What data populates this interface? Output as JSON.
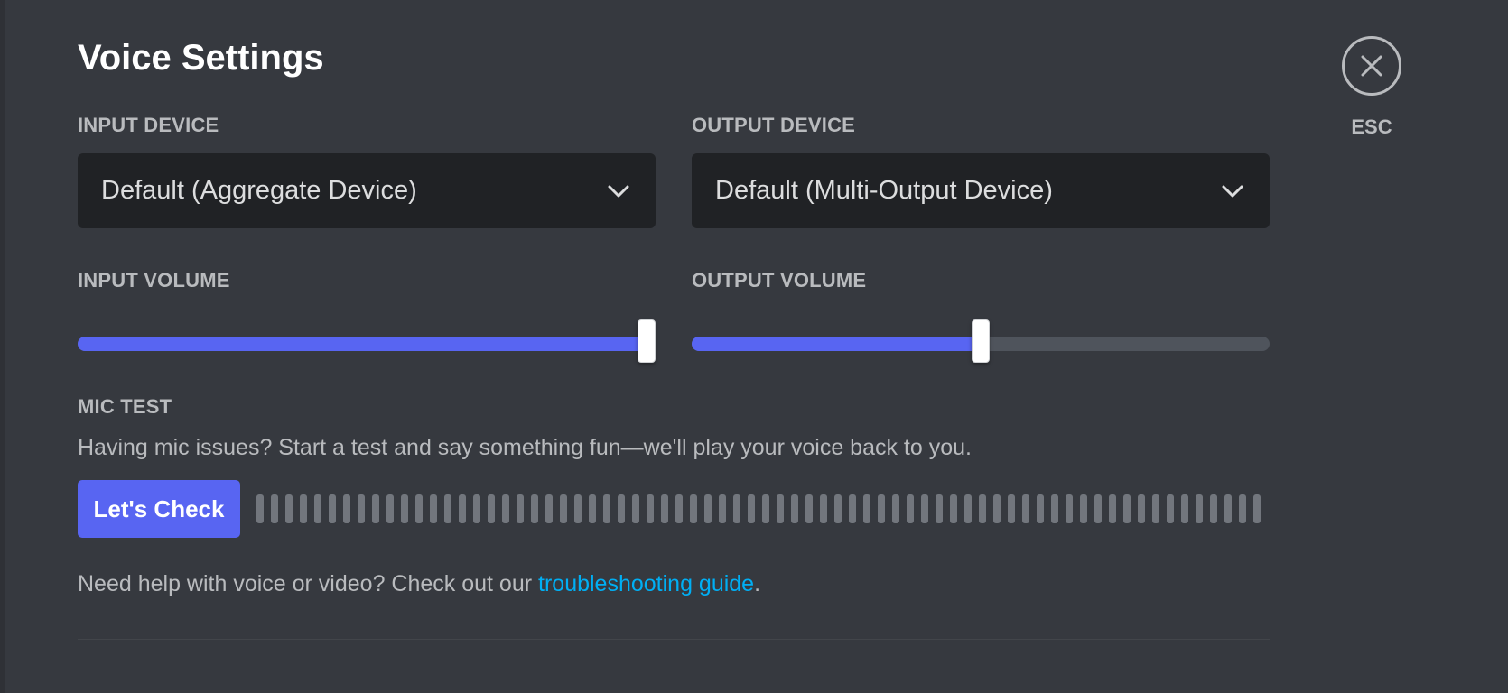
{
  "page": {
    "title": "Voice Settings"
  },
  "close": {
    "icon": "close-icon",
    "label": "ESC"
  },
  "input_device": {
    "label": "INPUT DEVICE",
    "value": "Default (Aggregate Device)",
    "icon": "chevron-down-icon"
  },
  "output_device": {
    "label": "OUTPUT DEVICE",
    "value": "Default (Multi-Output Device)",
    "icon": "chevron-down-icon"
  },
  "input_volume": {
    "label": "INPUT VOLUME",
    "level": 1.0
  },
  "output_volume": {
    "label": "OUTPUT VOLUME",
    "level": 0.5
  },
  "mic_test": {
    "label": "MIC TEST",
    "description": "Having mic issues? Start a test and say something fun—we'll play your voice back to you.",
    "button_label": "Let's Check",
    "meter_level": 0
  },
  "help": {
    "prefix": "Need help with voice or video? Check out our ",
    "link_text": "troubleshooting guide",
    "suffix": "."
  },
  "colors": {
    "background": "#36393f",
    "select_background": "#202225",
    "accent": "#5865f2",
    "link": "#00aff4",
    "muted_text": "#b9bbbe",
    "track": "#4f545c",
    "meter_bar": "#72767d"
  }
}
